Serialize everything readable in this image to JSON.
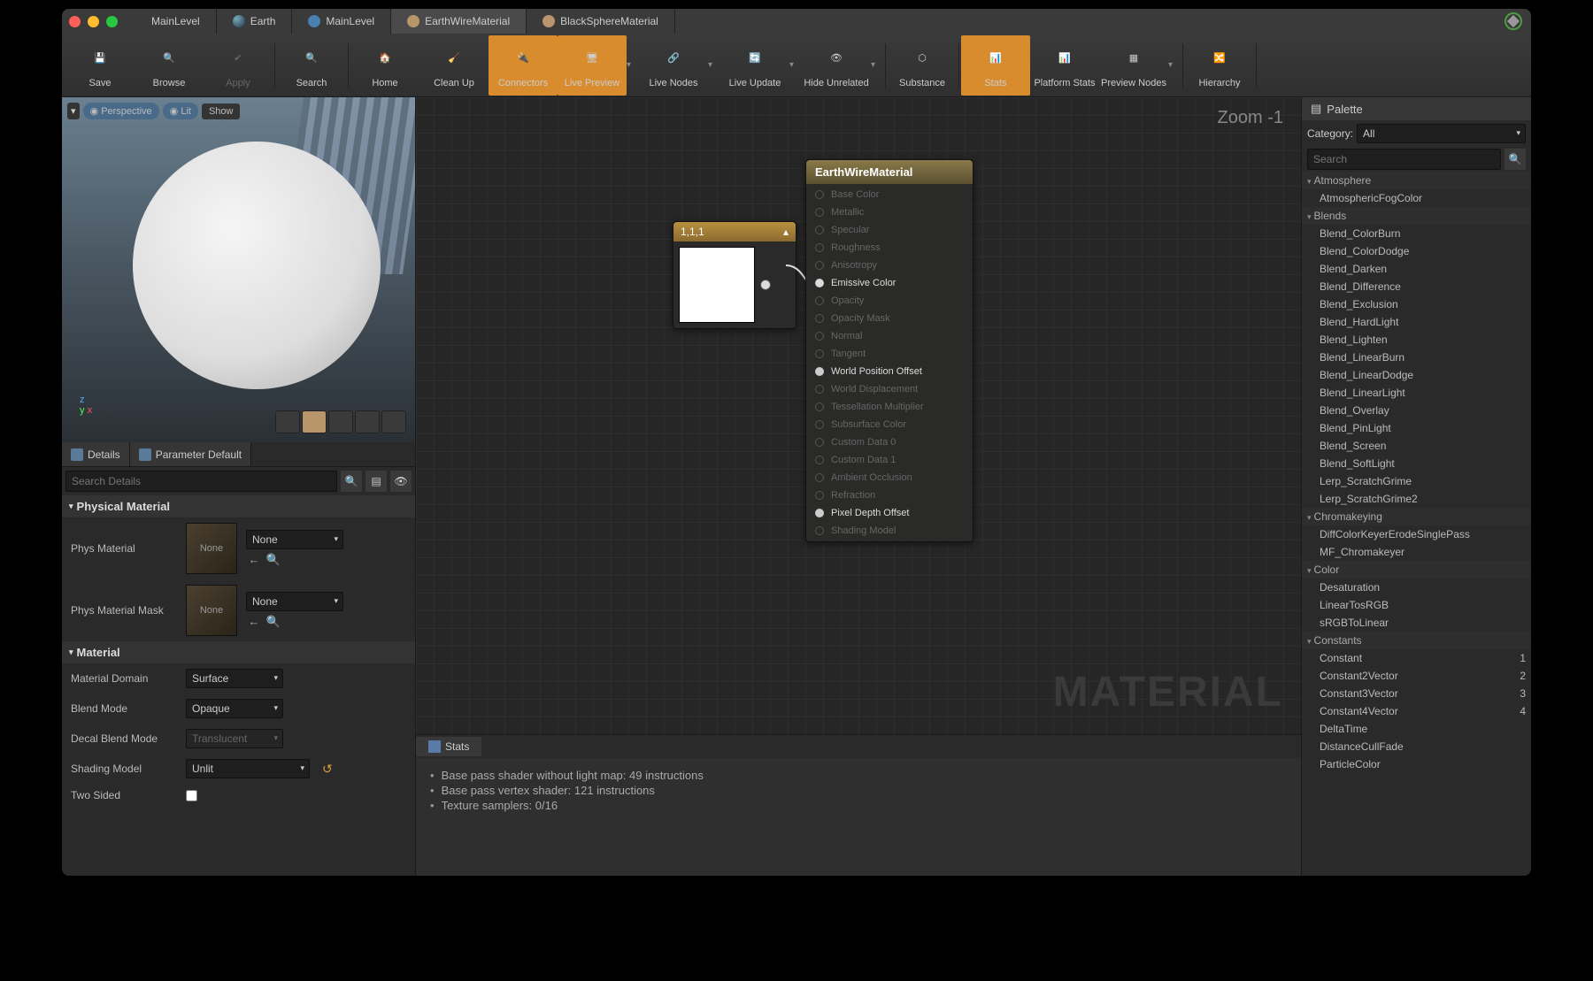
{
  "tabs": [
    "MainLevel",
    "Earth",
    "MainLevel",
    "EarthWireMaterial",
    "BlackSphereMaterial"
  ],
  "toolbar": [
    {
      "label": "Save",
      "active": false
    },
    {
      "label": "Browse",
      "active": false
    },
    {
      "label": "Apply",
      "active": false,
      "disabled": true
    },
    {
      "label": "Search",
      "active": false
    },
    {
      "label": "Home",
      "active": false
    },
    {
      "label": "Clean Up",
      "active": false
    },
    {
      "label": "Connectors",
      "active": true
    },
    {
      "label": "Live Preview",
      "active": true
    },
    {
      "label": "Live Nodes",
      "active": false
    },
    {
      "label": "Live Update",
      "active": false
    },
    {
      "label": "Hide Unrelated",
      "active": false
    },
    {
      "label": "Substance",
      "active": false
    },
    {
      "label": "Stats",
      "active": true
    },
    {
      "label": "Platform Stats",
      "active": false
    },
    {
      "label": "Preview Nodes",
      "active": false
    },
    {
      "label": "Hierarchy",
      "active": false
    }
  ],
  "viewport": {
    "perspective": "Perspective",
    "lit": "Lit",
    "show": "Show",
    "axes": {
      "x": "x",
      "y": "y",
      "z": "z"
    }
  },
  "panel_tabs": {
    "details": "Details",
    "param": "Parameter Default"
  },
  "details_search": "Search Details",
  "sections": {
    "phys": "Physical Material",
    "mat": "Material"
  },
  "phys_props": {
    "mat_lbl": "Phys Material",
    "mat_val": "None",
    "mat_thumb": "None",
    "mask_lbl": "Phys Material Mask",
    "mask_val": "None",
    "mask_thumb": "None"
  },
  "mat_props": {
    "domain_lbl": "Material Domain",
    "domain_val": "Surface",
    "blend_lbl": "Blend Mode",
    "blend_val": "Opaque",
    "decal_lbl": "Decal Blend Mode",
    "decal_val": "Translucent",
    "shading_lbl": "Shading Model",
    "shading_val": "Unlit",
    "two_lbl": "Two Sided"
  },
  "graph": {
    "zoom": "Zoom -1",
    "watermark": "MATERIAL",
    "const_node": {
      "title": "1,1,1"
    },
    "mat_node": {
      "title": "EarthWireMaterial",
      "pins": [
        {
          "name": "Base Color",
          "on": false
        },
        {
          "name": "Metallic",
          "on": false
        },
        {
          "name": "Specular",
          "on": false
        },
        {
          "name": "Roughness",
          "on": false
        },
        {
          "name": "Anisotropy",
          "on": false
        },
        {
          "name": "Emissive Color",
          "on": true,
          "filled": true
        },
        {
          "name": "Opacity",
          "on": false
        },
        {
          "name": "Opacity Mask",
          "on": false
        },
        {
          "name": "Normal",
          "on": false
        },
        {
          "name": "Tangent",
          "on": false
        },
        {
          "name": "World Position Offset",
          "on": true
        },
        {
          "name": "World Displacement",
          "on": false
        },
        {
          "name": "Tessellation Multiplier",
          "on": false
        },
        {
          "name": "Subsurface Color",
          "on": false
        },
        {
          "name": "Custom Data 0",
          "on": false
        },
        {
          "name": "Custom Data 1",
          "on": false
        },
        {
          "name": "Ambient Occlusion",
          "on": false
        },
        {
          "name": "Refraction",
          "on": false
        },
        {
          "name": "Pixel Depth Offset",
          "on": true
        },
        {
          "name": "Shading Model",
          "on": false
        }
      ]
    }
  },
  "stats": {
    "title": "Stats",
    "lines": [
      "Base pass shader without light map: 49 instructions",
      "Base pass vertex shader: 121 instructions",
      "Texture samplers: 0/16"
    ]
  },
  "palette": {
    "title": "Palette",
    "cat_lbl": "Category:",
    "cat_val": "All",
    "search": "Search",
    "groups": [
      {
        "name": "Atmosphere",
        "items": [
          {
            "n": "AtmosphericFogColor"
          }
        ]
      },
      {
        "name": "Blends",
        "items": [
          {
            "n": "Blend_ColorBurn"
          },
          {
            "n": "Blend_ColorDodge"
          },
          {
            "n": "Blend_Darken"
          },
          {
            "n": "Blend_Difference"
          },
          {
            "n": "Blend_Exclusion"
          },
          {
            "n": "Blend_HardLight"
          },
          {
            "n": "Blend_Lighten"
          },
          {
            "n": "Blend_LinearBurn"
          },
          {
            "n": "Blend_LinearDodge"
          },
          {
            "n": "Blend_LinearLight"
          },
          {
            "n": "Blend_Overlay"
          },
          {
            "n": "Blend_PinLight"
          },
          {
            "n": "Blend_Screen"
          },
          {
            "n": "Blend_SoftLight"
          },
          {
            "n": "Lerp_ScratchGrime"
          },
          {
            "n": "Lerp_ScratchGrime2"
          }
        ]
      },
      {
        "name": "Chromakeying",
        "items": [
          {
            "n": "DiffColorKeyerErodeSinglePass"
          },
          {
            "n": "MF_Chromakeyer"
          }
        ]
      },
      {
        "name": "Color",
        "items": [
          {
            "n": "Desaturation"
          },
          {
            "n": "LinearTosRGB"
          },
          {
            "n": "sRGBToLinear"
          }
        ]
      },
      {
        "name": "Constants",
        "items": [
          {
            "n": "Constant",
            "k": "1"
          },
          {
            "n": "Constant2Vector",
            "k": "2"
          },
          {
            "n": "Constant3Vector",
            "k": "3"
          },
          {
            "n": "Constant4Vector",
            "k": "4"
          },
          {
            "n": "DeltaTime"
          },
          {
            "n": "DistanceCullFade"
          },
          {
            "n": "ParticleColor"
          }
        ]
      }
    ]
  }
}
